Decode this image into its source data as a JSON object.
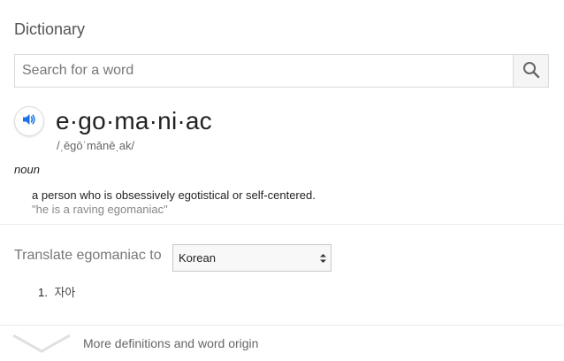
{
  "title": "Dictionary",
  "search": {
    "placeholder": "Search for a word",
    "icon": "search-icon"
  },
  "entry": {
    "word": "e·go·ma·ni·ac",
    "phonetic": "/ˌēgōˈmānēˌak/",
    "part_of_speech": "noun",
    "definition": "a person who is obsessively egotistical or self-centered.",
    "example": "\"he is a raving egomaniac\""
  },
  "translate": {
    "label": "Translate egomaniac to",
    "selected_language": "Korean",
    "results": [
      {
        "number": "1.",
        "text": "자아"
      }
    ]
  },
  "more": {
    "label": "More definitions and word origin"
  },
  "colors": {
    "speaker_blue": "#1a73e8",
    "divider": "#ebebeb",
    "muted_text": "#777777"
  }
}
